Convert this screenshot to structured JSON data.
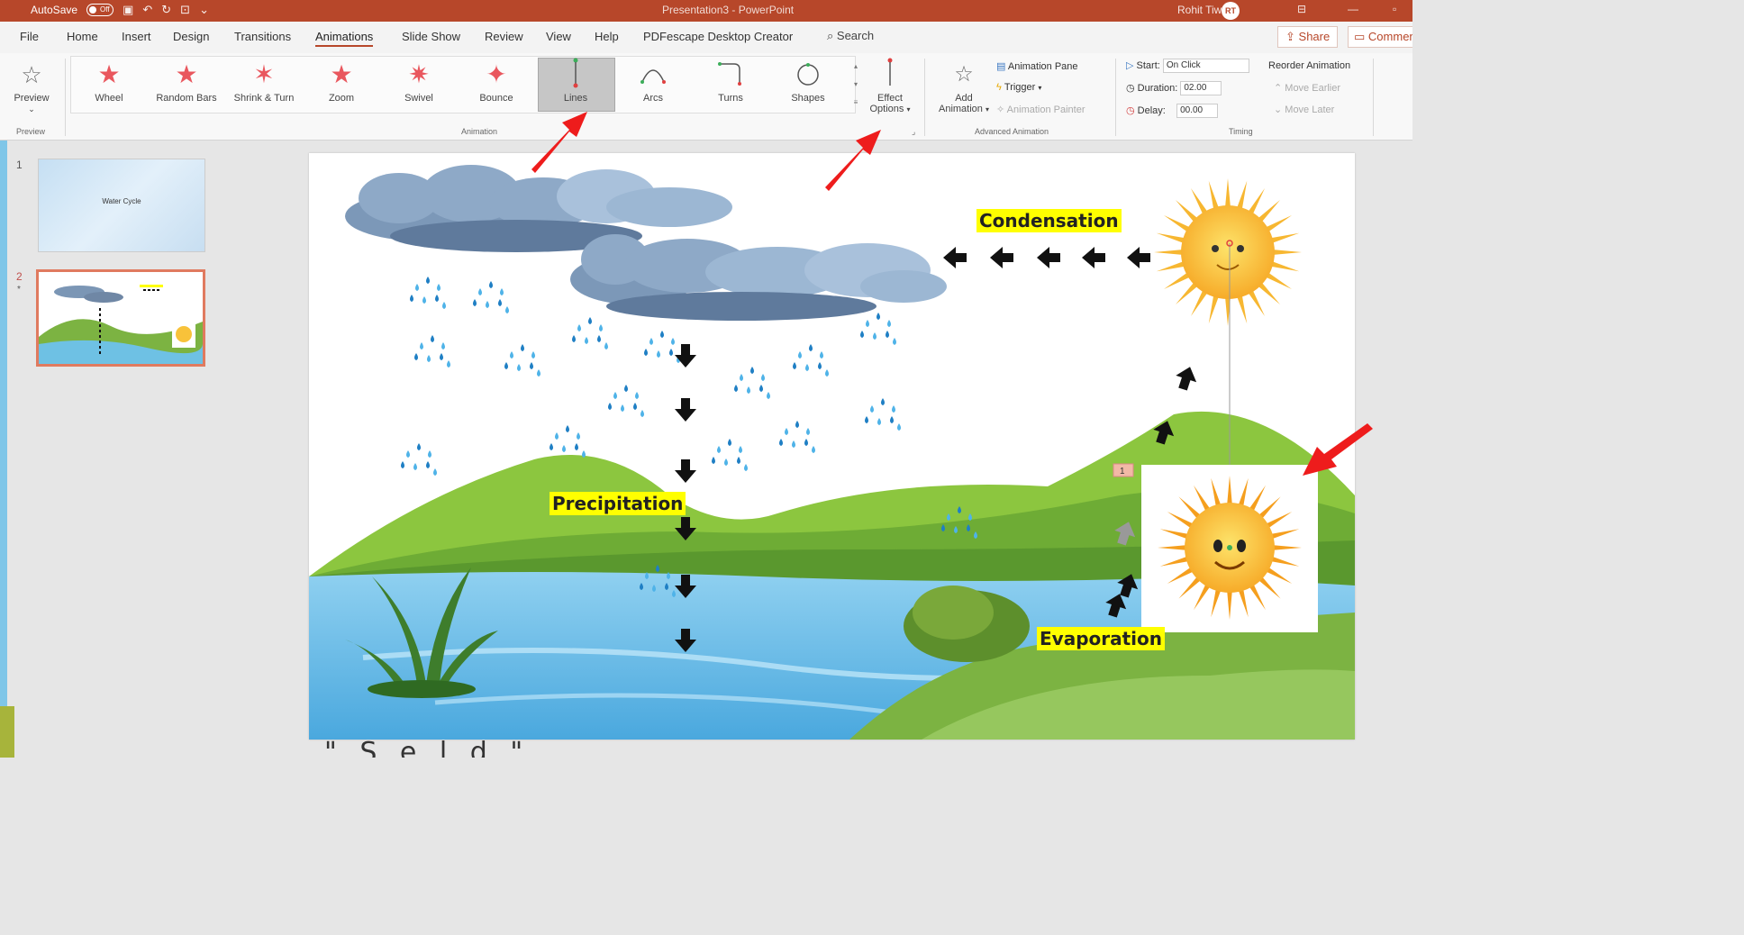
{
  "titlebar": {
    "autosave_label": "AutoSave",
    "autosave_state": "Off",
    "document_title": "Presentation3 - PowerPoint",
    "user_name": "Rohit Tiwari",
    "user_initials": "RT"
  },
  "tabs": [
    "File",
    "Home",
    "Insert",
    "Design",
    "Transitions",
    "Animations",
    "Slide Show",
    "Review",
    "View",
    "Help",
    "PDFescape Desktop Creator"
  ],
  "active_tab": "Animations",
  "search_label": "Search",
  "share_label": "Share",
  "comments_label": "Comments",
  "ribbon": {
    "preview": {
      "label": "Preview",
      "group": "Preview"
    },
    "animations": [
      {
        "label": "Wheel",
        "icon": "wheel-star-icon"
      },
      {
        "label": "Random Bars",
        "icon": "random-bars-star-icon"
      },
      {
        "label": "Shrink & Turn",
        "icon": "shrink-turn-star-icon"
      },
      {
        "label": "Zoom",
        "icon": "zoom-star-icon"
      },
      {
        "label": "Swivel",
        "icon": "swivel-star-icon"
      },
      {
        "label": "Bounce",
        "icon": "bounce-star-icon"
      },
      {
        "label": "Lines",
        "icon": "lines-path-icon",
        "selected": true
      },
      {
        "label": "Arcs",
        "icon": "arcs-path-icon"
      },
      {
        "label": "Turns",
        "icon": "turns-path-icon"
      },
      {
        "label": "Shapes",
        "icon": "shapes-path-icon"
      }
    ],
    "effect_options": {
      "line1": "Effect",
      "line2": "Options"
    },
    "animation_group": "Animation",
    "advanced": {
      "add_animation_line1": "Add",
      "add_animation_line2": "Animation",
      "animation_pane": "Animation Pane",
      "trigger": "Trigger",
      "animation_painter": "Animation Painter",
      "group": "Advanced Animation"
    },
    "timing": {
      "start_label": "Start:",
      "start_value": "On Click",
      "duration_label": "Duration:",
      "duration_value": "02.00",
      "delay_label": "Delay:",
      "delay_value": "00.00",
      "reorder_label": "Reorder Animation",
      "move_earlier": "Move Earlier",
      "move_later": "Move Later",
      "group": "Timing"
    }
  },
  "slides_panel": {
    "slide1_number": "1",
    "slide1_title": "Water Cycle",
    "slide2_number": "2",
    "slide2_marker": "*"
  },
  "slide": {
    "condensation": "Condensation",
    "precipitation": "Precipitation",
    "evaporation": "Evaporation",
    "animation_tag": "1"
  },
  "bottom_caption": "\" S     e     l        d         \""
}
